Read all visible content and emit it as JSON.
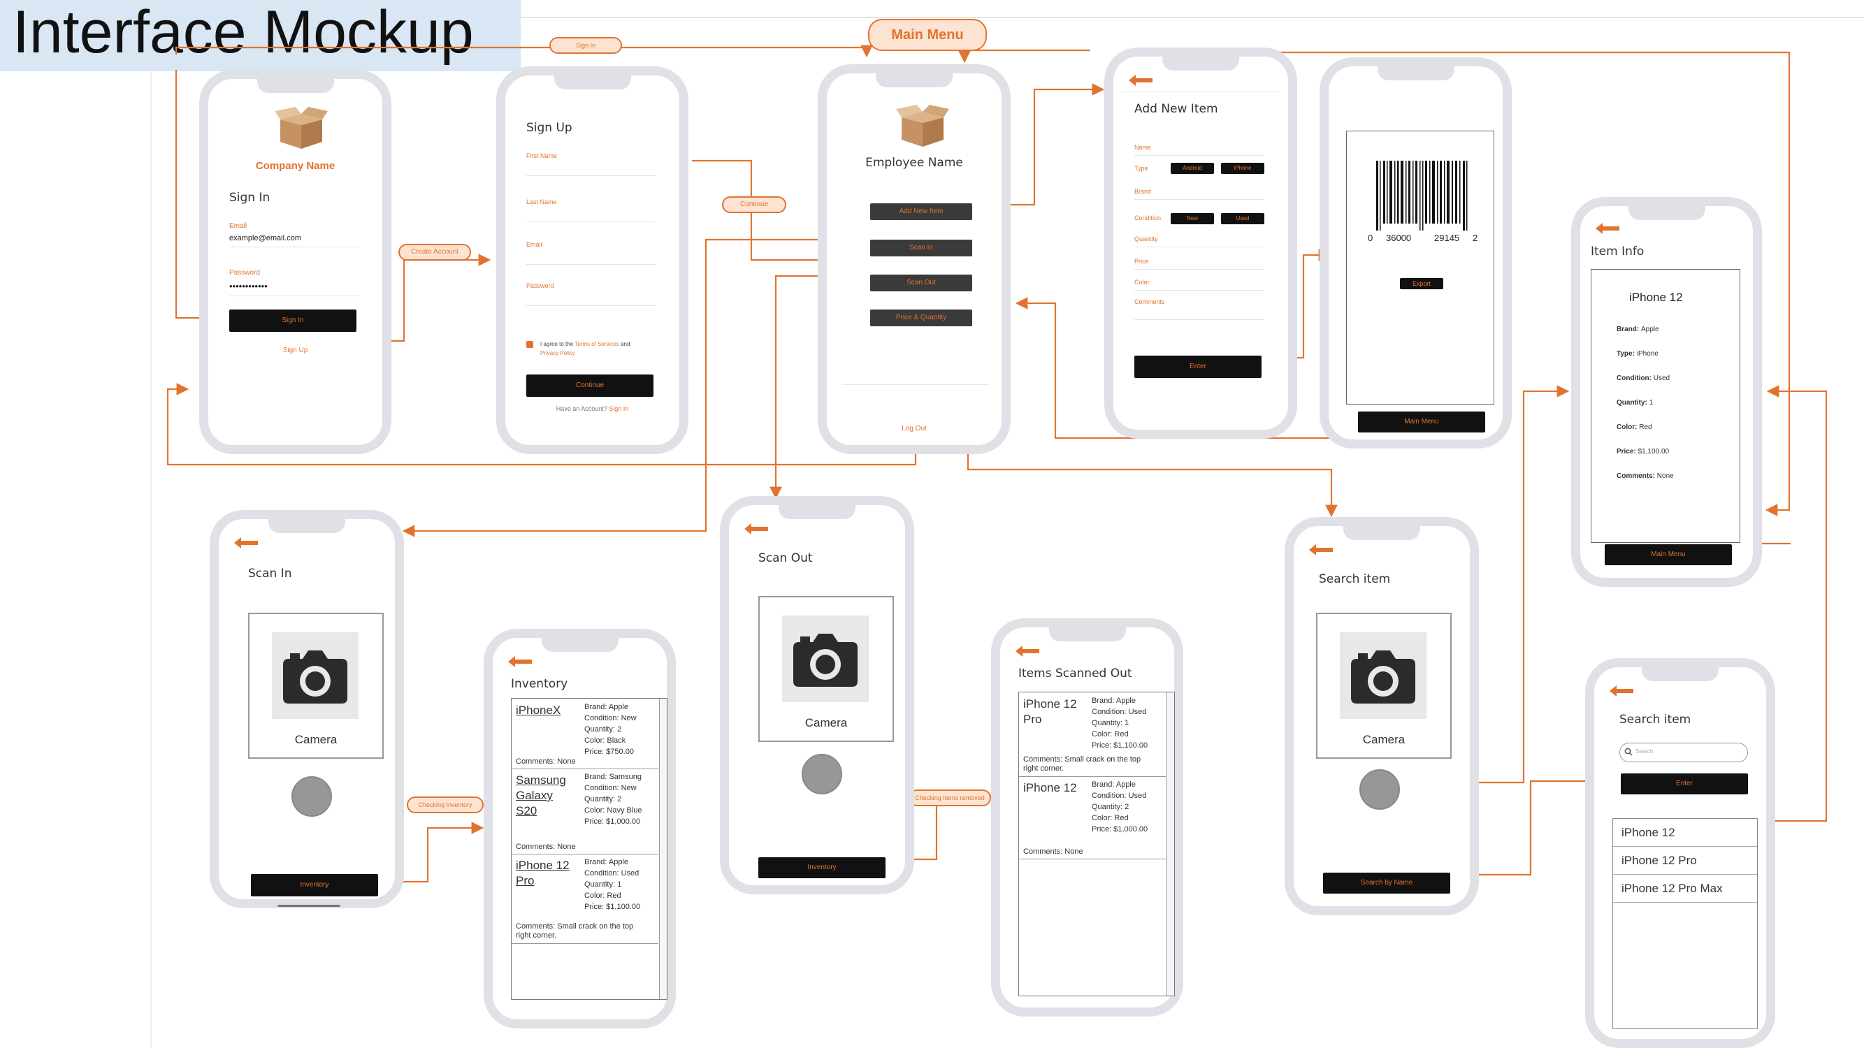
{
  "page": {
    "title": "Interface Mockup"
  },
  "pills": {
    "sign_in": "Sign In",
    "main_menu": "Main Menu",
    "create_account": "Create Account",
    "continue": "Continue",
    "checking_inventory": "Checking Inventory",
    "checking_items_removed": "Checking Items removed"
  },
  "signin": {
    "company": "Company Name",
    "heading": "Sign In",
    "email_label": "Email",
    "email_value": "example@email.com",
    "password_label": "Password",
    "password_value": "••••••••••••",
    "button": "Sign In",
    "signup_link": "Sign Up"
  },
  "signup": {
    "heading": "Sign Up",
    "first_name": "First Name",
    "last_name": "Last Name",
    "email": "Email",
    "password": "Password",
    "agree": "I agree to the",
    "terms": "Terms of Services",
    "and": "and",
    "privacy": "Privacy Policy",
    "button": "Continue",
    "have_account": "Have an Account?",
    "signin_link": "Sign In"
  },
  "menu": {
    "employee": "Employee Name",
    "add": "Add New Item",
    "scan_in": "Scan In",
    "scan_out": "Scan Out",
    "price": "Price & Quantity",
    "logout": "Log Out"
  },
  "additem": {
    "heading": "Add New Item",
    "name": "Name",
    "type": "Type",
    "type_opt1": "Android",
    "type_opt2": "iPhone",
    "brand": "Brand",
    "condition": "Condition",
    "cond_opt1": "New",
    "cond_opt2": "Used",
    "quantity": "Quantity",
    "price": "Price",
    "color": "Color",
    "comments": "Comments",
    "button": "Enter"
  },
  "barcode": {
    "digits": [
      "0",
      "36000",
      "29145",
      "2"
    ],
    "export": "Export",
    "main_menu": "Main Menu"
  },
  "iteminfo": {
    "heading": "Item Info",
    "name": "iPhone 12",
    "fields": [
      {
        "k": "Brand:",
        "v": "Apple"
      },
      {
        "k": "Type:",
        "v": "iPhone"
      },
      {
        "k": "Condition:",
        "v": "Used"
      },
      {
        "k": "Quantity:",
        "v": "1"
      },
      {
        "k": "Color:",
        "v": "Red"
      },
      {
        "k": "Price:",
        "v": "$1,100.00"
      },
      {
        "k": "Comments:",
        "v": "None"
      }
    ],
    "main_menu": "Main Menu"
  },
  "scanin": {
    "heading": "Scan In",
    "camera": "Camera",
    "button": "Inventory"
  },
  "inventory": {
    "heading": "Inventory",
    "items": [
      {
        "name": "iPhoneX",
        "details": "Brand: Apple\nCondition: New\nQuantity: 2\nColor: Black\nPrice: $750.00",
        "comments": "Comments: None"
      },
      {
        "name": "Samsung\nGalaxy\nS20",
        "details": "Brand: Samsung\nCondition: New\nQuantity: 2\nColor: Navy Blue\nPrice: $1,000.00",
        "comments": "Comments: None"
      },
      {
        "name": "iPhone 12\nPro",
        "details": "Brand: Apple\nCondition: Used\nQuantity: 1\nColor:  Red\nPrice: $1,100.00",
        "comments": "Comments: Small crack on the top\nright corner."
      }
    ]
  },
  "scanout": {
    "heading": "Scan Out",
    "camera": "Camera",
    "button": "Inventory"
  },
  "scannedout": {
    "heading": "Items Scanned Out",
    "items": [
      {
        "name": "iPhone 12\nPro",
        "details": "Brand: Apple\nCondition: Used\nQuantity: 1\nColor:  Red\nPrice: $1,100.00",
        "comments": "Comments: Small crack on the top\nright corner."
      },
      {
        "name": "iPhone 12",
        "details": "Brand: Apple\nCondition: Used\nQuantity: 2\nColor:  Red\nPrice: $1,000.00",
        "comments": "Comments: None"
      }
    ]
  },
  "search1": {
    "heading": "Search item",
    "camera": "Camera",
    "button": "Search by Name"
  },
  "search2": {
    "heading": "Search item",
    "placeholder": "Search",
    "button": "Enter",
    "results": [
      "iPhone 12",
      "iPhone 12 Pro",
      "iPhone 12 Pro Max"
    ]
  },
  "colors": {
    "accent": "#e2732f",
    "frame": "#dfe1e6",
    "button": "#111111",
    "title_bg": "#d9e6f3"
  },
  "icons": [
    "box-icon",
    "camera-icon",
    "back-arrow-icon",
    "search-icon",
    "barcode-icon",
    "checkbox-icon"
  ]
}
